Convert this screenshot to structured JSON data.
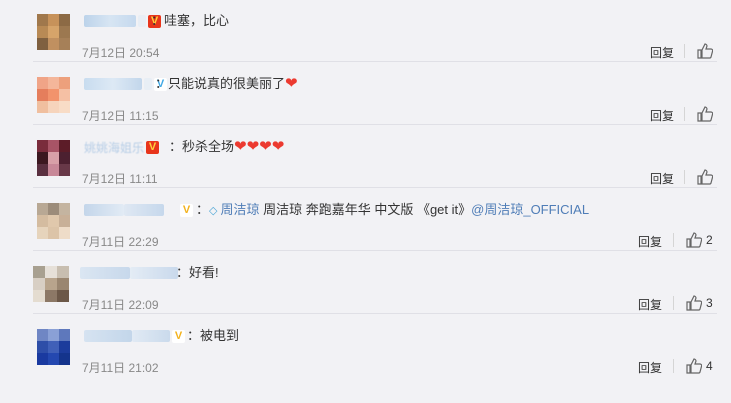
{
  "comments": [
    {
      "badge": "V",
      "badge_color": "#e8351b",
      "text": "：哇塞，比心",
      "time": "7月12日 20:54",
      "reply": "回复",
      "likes": ""
    },
    {
      "badge": "V",
      "badge_color": "#40a8e5",
      "text": "：只能说真的很美丽了",
      "time": "7月12日 11:15",
      "reply": "回复",
      "likes": ""
    },
    {
      "name_visible": "姚姚海姐乐",
      "badge": "V",
      "badge_color": "#e8351b",
      "text": "：秒杀全场",
      "time": "7月12日 11:11",
      "reply": "回复",
      "likes": ""
    },
    {
      "badge": "V",
      "badge_color": "#f3b21d",
      "text_prefix": "：",
      "link1": "周洁琼",
      "text_mid": " 周洁琼 奔跑嘉年华 中文版 《get it》",
      "link2": "@周洁琼_OFFICIAL",
      "time": "7月11日 22:29",
      "reply": "回复",
      "likes": "2"
    },
    {
      "text": "：好看!",
      "time": "7月11日 22:09",
      "reply": "回复",
      "likes": "3"
    },
    {
      "badge": "V",
      "badge_color": "#f3b21d",
      "text": "：被电到",
      "time": "7月11日 21:02",
      "reply": "回复",
      "likes": "4"
    }
  ],
  "icons": {
    "like": "thumbs-up-icon",
    "heart": "heart-icon",
    "gem": "diamond-icon",
    "verified": "verified-v-icon"
  },
  "colors": {
    "background": "#f2f2f5",
    "link": "#4f7db7",
    "time": "#888888"
  }
}
